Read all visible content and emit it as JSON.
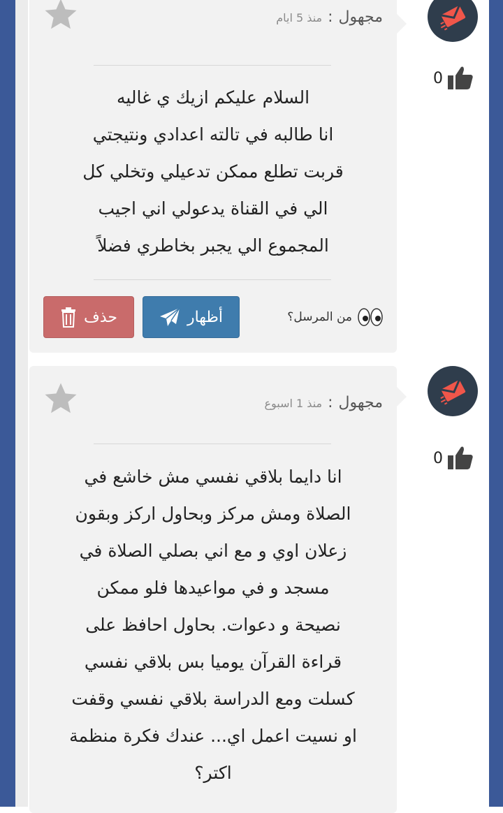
{
  "messages": [
    {
      "author": "مجهول",
      "separator": ":",
      "time": "منذ 5 ايام",
      "likes": "0",
      "text": "السلام عليكم ازيك ي غاليه\nانا طالبه في تالته اعدادي ونتيجتي\nقربت تطلع ممكن تدعيلي وتخلي كل\nالي في القناة يدعولي اني اجيب\nالمجموع الي يجبر بخاطري فضلاً",
      "sender_label": "من المرسل؟",
      "show_label": "أظهار",
      "delete_label": "حذف"
    },
    {
      "author": "مجهول",
      "separator": ":",
      "time": "منذ 1 اسبوع",
      "likes": "0",
      "text": "انا دايما بلاقي نفسي مش خاشع في\nالصلاة ومش مركز وبحاول اركز وبقون\nزعلان اوي و مع اني بصلي الصلاة في\nمسجد و في مواعيدها فلو ممكن\nنصيحة و دعوات. بحاول احافظ على\nقراءة القرآن يوميا بس بلاقي نفسي\nكسلت ومع الدراسة بلاقي نفسي وقفت\nاو نسيت اعمل اي... عندك فكرة منظمة\nاكتر؟"
    }
  ],
  "colors": {
    "frame": "#3b5998",
    "delete_button": "#c96b6b",
    "show_button": "#3f7cad",
    "avatar_bg": "#2f3d4c",
    "avatar_icon": "#f0564a"
  },
  "icons": [
    "star-icon",
    "thumbs-up-icon",
    "envelope-icon",
    "eyes-icon",
    "paper-plane-icon",
    "trash-icon"
  ]
}
